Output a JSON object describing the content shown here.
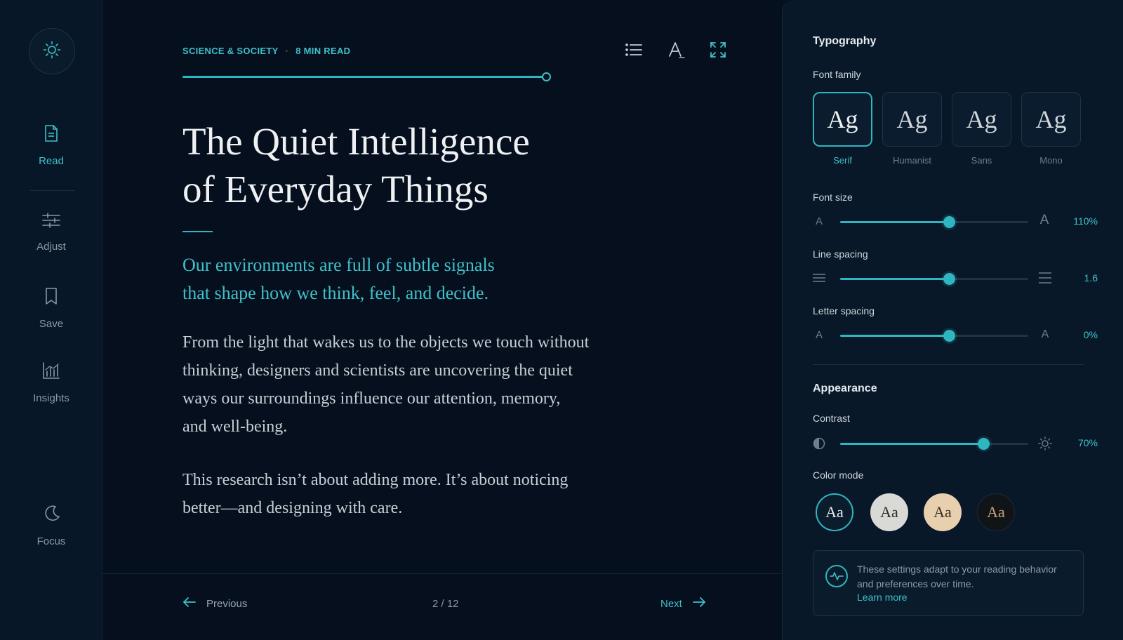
{
  "sidebar": {
    "items": [
      {
        "label": "Read",
        "icon": "document-icon",
        "active": true
      },
      {
        "label": "Adjust",
        "icon": "sliders-icon",
        "active": false
      },
      {
        "label": "Save",
        "icon": "bookmark-icon",
        "active": false
      },
      {
        "label": "Insights",
        "icon": "bar-chart-icon",
        "active": false
      },
      {
        "label": "Focus",
        "icon": "moon-icon",
        "active": false
      }
    ]
  },
  "article": {
    "category": "SCIENCE & SOCIETY",
    "separator": "·",
    "read_time": "8 MIN READ",
    "progress": 1.0,
    "title_line1": "The Quiet Intelligence",
    "title_line2": "of Everyday Things",
    "lede_line1": "Our environments are full of subtle signals",
    "lede_line2": "that shape how we think, feel, and decide.",
    "para1_lines": [
      "From the light that wakes us to the objects we touch without",
      "thinking, designers and scientists are uncovering the quiet",
      "ways our surroundings influence our attention, memory,",
      "and well-being."
    ],
    "para2_lines": [
      "This research isn’t about adding more. It’s about noticing",
      "better—and designing with care."
    ]
  },
  "footer": {
    "prev_label": "Previous",
    "page_indicator": "2 / 12",
    "next_label": "Next"
  },
  "panel": {
    "typography_heading": "Typography",
    "font_family_label": "Font family",
    "font_families": [
      {
        "sample": "Ag",
        "label": "Serif",
        "selected": true
      },
      {
        "sample": "Ag",
        "label": "Humanist",
        "selected": false
      },
      {
        "sample": "Ag",
        "label": "Sans",
        "selected": false
      },
      {
        "sample": "Ag",
        "label": "Mono",
        "selected": false
      }
    ],
    "font_size": {
      "label": "Font size",
      "value": "110%",
      "level": 0.58,
      "min_glyph": "A",
      "max_glyph": "A"
    },
    "line_spacing": {
      "label": "Line spacing",
      "value": "1.6",
      "level": 0.58
    },
    "letter_spacing": {
      "label": "Letter spacing",
      "value": "0%",
      "level": 0.58,
      "min_glyph": "A",
      "max_glyph": "A"
    },
    "appearance_heading": "Appearance",
    "contrast": {
      "label": "Contrast",
      "value": "70%",
      "level": 0.76
    },
    "color_mode_label": "Color mode",
    "color_modes": [
      {
        "sample": "Aa",
        "bg": "#0b1c2c",
        "fg": "#e8ecef",
        "selected": true
      },
      {
        "sample": "Aa",
        "bg": "#d9d9d6",
        "fg": "#2a2a2a",
        "selected": false
      },
      {
        "sample": "Aa",
        "bg": "#e8cfae",
        "fg": "#3a2e22",
        "selected": false
      },
      {
        "sample": "Aa",
        "bg": "#111417",
        "fg": "#c9a27a",
        "selected": false
      }
    ],
    "info_text": "These settings adapt to your reading behavior and preferences over time.",
    "info_link": "Learn more"
  },
  "colors": {
    "accent": "#3fc1c9",
    "background": "#050f1e",
    "panel": "#081828"
  }
}
